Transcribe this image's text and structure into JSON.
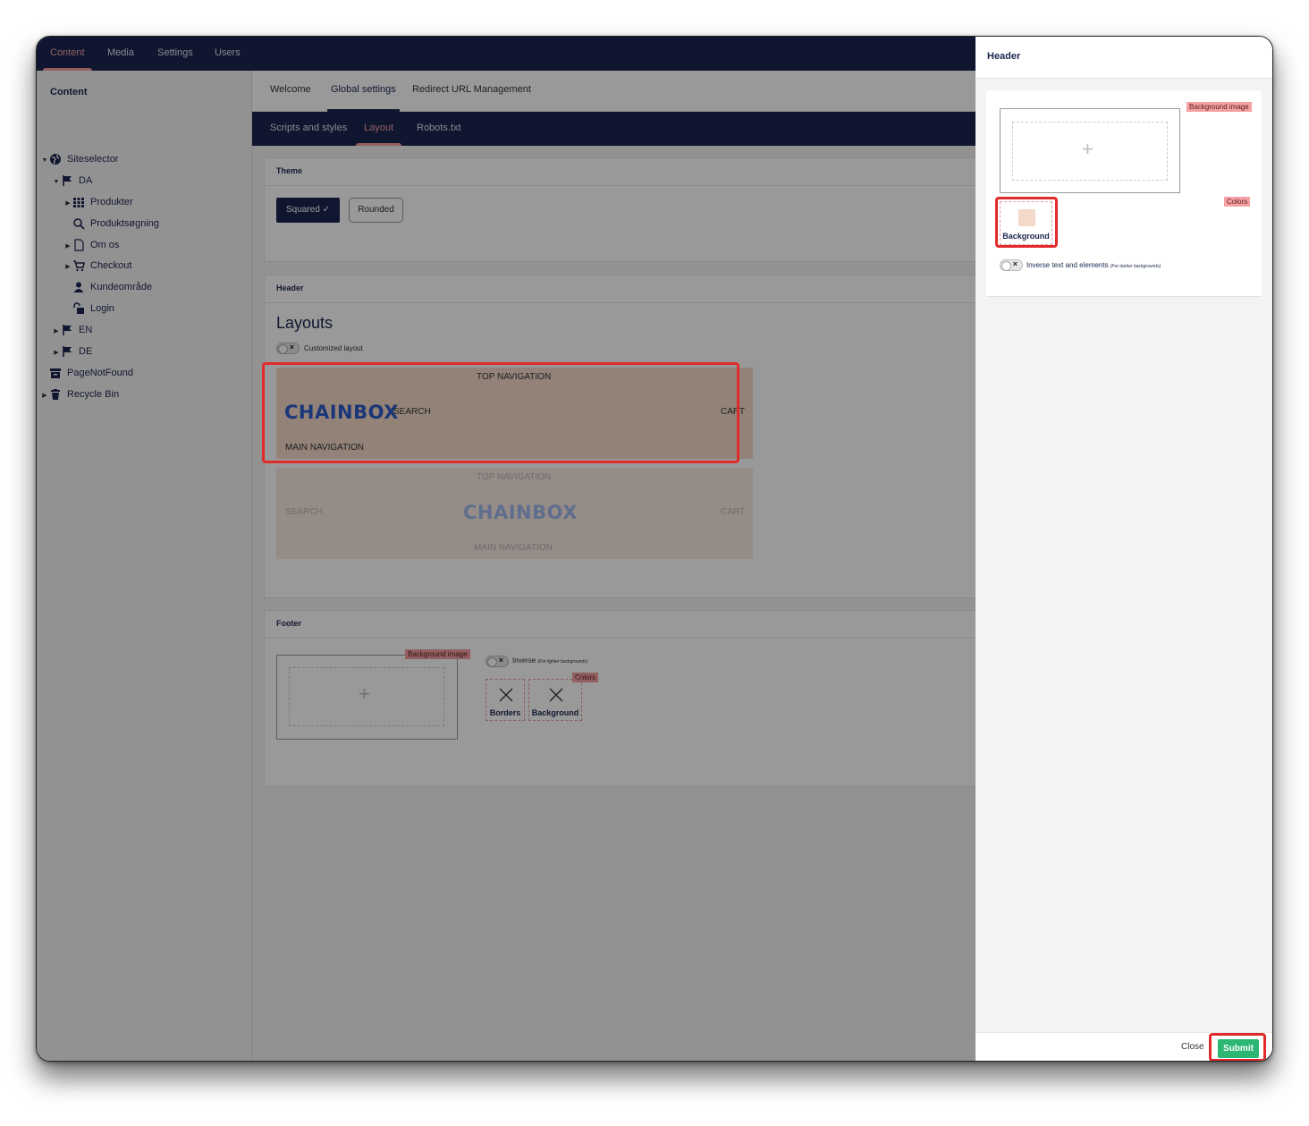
{
  "topnav": {
    "items": [
      "Content",
      "Media",
      "Settings",
      "Users"
    ],
    "active": "Content",
    "accent": "#f5a1a3",
    "bg": "#1b264f"
  },
  "sidebar": {
    "title": "Content",
    "tree": [
      {
        "label": "Siteselector",
        "icon": "globe-icon"
      },
      {
        "label": "DA",
        "icon": "flag-icon"
      },
      {
        "label": "Produkter",
        "icon": "grid-icon"
      },
      {
        "label": "Produktsøgning",
        "icon": "search-icon"
      },
      {
        "label": "Om os",
        "icon": "document-icon"
      },
      {
        "label": "Checkout",
        "icon": "cart-icon"
      },
      {
        "label": "Kundeområde",
        "icon": "user-icon"
      },
      {
        "label": "Login",
        "icon": "unlock-icon"
      },
      {
        "label": "EN",
        "icon": "flag-icon"
      },
      {
        "label": "DE",
        "icon": "flag-icon"
      },
      {
        "label": "PageNotFound",
        "icon": "archive-icon"
      },
      {
        "label": "Recycle Bin",
        "icon": "trash-icon"
      }
    ]
  },
  "tabs": {
    "primary": [
      "Welcome",
      "Global settings",
      "Redirect URL Management"
    ],
    "primary_active": "Global settings",
    "secondary": [
      "Scripts and styles",
      "Layout",
      "Robots.txt"
    ],
    "secondary_active": "Layout"
  },
  "theme": {
    "title": "Theme",
    "squared": "Squared ✓",
    "rounded": "Rounded"
  },
  "header_panel": {
    "title": "Header",
    "layouts_heading": "Layouts",
    "customized_toggle": "Customized layout",
    "layout1": {
      "top": "TOP NAVIGATION",
      "logo": "CHAINBOX",
      "search": "SEARCH",
      "cart": "CART",
      "main": "MAIN NAVIGATION"
    },
    "layout2": {
      "top": "TOP NAVIGATION",
      "logo": "CHAINBOX",
      "search": "SEARCH",
      "cart": "CART",
      "main": "MAIN NAVIGATION"
    },
    "layout_bg": "#f3d9c9"
  },
  "footer_panel": {
    "title": "Footer",
    "bg_image_tag": "Background image",
    "inverse_label": "Inverse",
    "inverse_note": "(For lighter backgrounds)",
    "colors_tag": "Colors",
    "borders": "Borders",
    "background": "Background"
  },
  "drawer": {
    "title": "Header",
    "bg_image_tag": "Background image",
    "colors_tag": "Colors",
    "background_label": "Background",
    "background_color": "#f3d9c9",
    "inverse_label": "Inverse text and elements",
    "inverse_note": "(For darker backgrounds)",
    "close": "Close",
    "submit": "Submit",
    "submit_color": "#2bb673"
  }
}
